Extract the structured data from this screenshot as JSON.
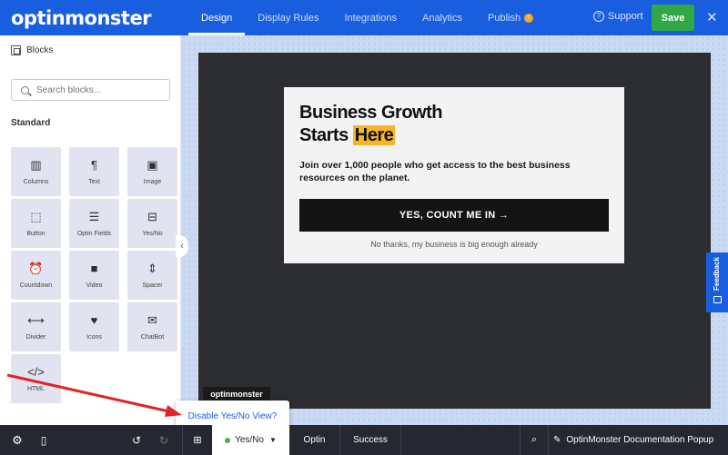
{
  "header": {
    "logo": "optinmonster",
    "tabs": [
      {
        "label": "Design"
      },
      {
        "label": "Display Rules"
      },
      {
        "label": "Integrations"
      },
      {
        "label": "Analytics"
      },
      {
        "label": "Publish"
      }
    ],
    "publish_badge": "!",
    "support_label": "Support",
    "save_label": "Save",
    "close_glyph": "✕"
  },
  "sidebar": {
    "title": "Blocks",
    "search_placeholder": "Search blocks...",
    "section_label": "Standard",
    "blocks": [
      {
        "label": "Columns",
        "icon": "columns-icon",
        "glyph": "▥"
      },
      {
        "label": "Text",
        "icon": "paragraph-icon",
        "glyph": "¶"
      },
      {
        "label": "Image",
        "icon": "image-icon",
        "glyph": "▣"
      },
      {
        "label": "Button",
        "icon": "button-icon",
        "glyph": "⬚"
      },
      {
        "label": "Optin Fields",
        "icon": "form-fields-icon",
        "glyph": "☰"
      },
      {
        "label": "Yes/No",
        "icon": "yes-no-icon",
        "glyph": "⊟"
      },
      {
        "label": "Countdown",
        "icon": "alarm-clock-icon",
        "glyph": "⏰"
      },
      {
        "label": "Video",
        "icon": "video-camera-icon",
        "glyph": "■"
      },
      {
        "label": "Spacer",
        "icon": "spacer-icon",
        "glyph": "⇕"
      },
      {
        "label": "Divider",
        "icon": "divider-icon",
        "glyph": "⟷"
      },
      {
        "label": "Icons",
        "icon": "heart-circle-icon",
        "glyph": "♥"
      },
      {
        "label": "ChatBot",
        "icon": "chat-icon",
        "glyph": "✉"
      },
      {
        "label": "HTML",
        "icon": "code-icon",
        "glyph": "</>"
      }
    ]
  },
  "popup": {
    "title_line1": "Business Growth",
    "title_line2_prefix": "Starts",
    "title_highlight": "Here",
    "subtitle": "Join over 1,000 people who get access to the best business resources on the planet.",
    "cta_label": "YES, COUNT ME IN →",
    "no_thanks": "No thanks, my business is big enough already",
    "powered_badge": "optinmonster"
  },
  "feedback_label": "Feedback",
  "tooltip": {
    "text": "Disable Yes/No View?"
  },
  "bottombar": {
    "yesno_label": "Yes/No",
    "optin_label": "Optin",
    "success_label": "Success",
    "campaign_name": "OptinMonster Documentation Popup"
  },
  "colors": {
    "brand_blue": "#1a5ee0",
    "save_green": "#2fa845",
    "highlight": "#f6b628",
    "arrow_red": "#e0242a"
  }
}
